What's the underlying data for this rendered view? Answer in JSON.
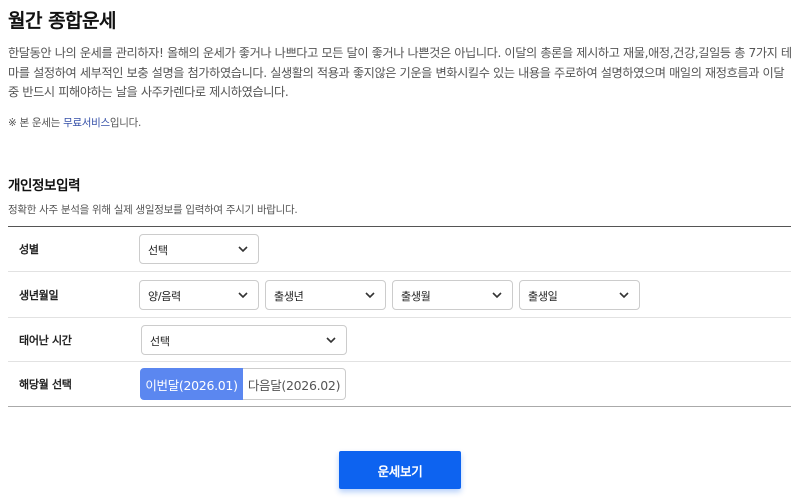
{
  "page": {
    "title": "월간 종합운세",
    "intro": "한달동안 나의 운세를 관리하자! 올해의 운세가 좋거나 나쁘다고 모든 달이 좋거나 나쁜것은 아닙니다. 이달의 총론을 제시하고 재물,애정,건강,길일등 총 7가지 테마를 설정하여 세부적인 보충 설명을 첨가하였습니다. 실생활의 적용과 좋지않은 기운을 변화시킬수 있는 내용을 주로하여 설명하였으며 매일의 재정흐름과 이달중 반드시 피해야하는 날을 사주카렌다로 제시하였습니다.",
    "note_prefix": "※ 본 운세는 ",
    "note_link": "무료서비스",
    "note_suffix": "입니다."
  },
  "form": {
    "title": "개인정보입력",
    "description": "정확한 사주 분석을 위해 실제 생일정보를 입력하여 주시기 바랍니다.",
    "gender": {
      "label": "성별",
      "value": "선택"
    },
    "birth": {
      "label": "생년월일",
      "calendar": "양/음력",
      "year": "출생년",
      "month": "출생월",
      "day": "출생일"
    },
    "birth_time": {
      "label": "태어난 시간",
      "value": "선택"
    },
    "target_month": {
      "label": "해당월 선택",
      "this_month": "이번달(2026.01)",
      "next_month": "다음달(2026.02)",
      "selected": "this_month"
    },
    "submit_label": "운세보기"
  },
  "colors": {
    "accent": "#0d63f0",
    "toggle_active": "#5b87f0",
    "link": "#3550a8"
  },
  "icons": {
    "dropdown": "chevron-down-icon"
  }
}
